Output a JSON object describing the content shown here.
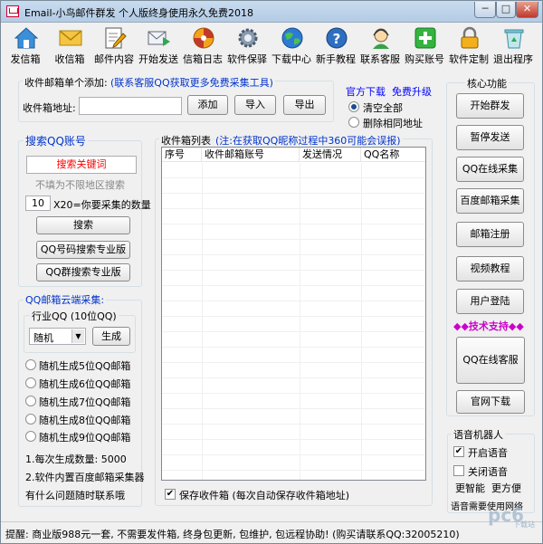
{
  "window": {
    "title": "Email-小鸟邮件群发 个人版终身使用永久免费2018",
    "min": "─",
    "max": "□",
    "close": "✕"
  },
  "toolbar": [
    {
      "label": "发信箱",
      "icon": "home-icon",
      "name": "tool-send-box"
    },
    {
      "label": "收信箱",
      "icon": "envelope-icon",
      "name": "tool-inbox"
    },
    {
      "label": "邮件内容",
      "icon": "edit-document-icon",
      "name": "tool-mail-content"
    },
    {
      "label": "开始发送",
      "icon": "send-mail-icon",
      "name": "tool-start-send"
    },
    {
      "label": "信箱日志",
      "icon": "log-disc-icon",
      "name": "tool-mailbox-log"
    },
    {
      "label": "软件保驿",
      "icon": "gear-icon",
      "name": "tool-settings"
    },
    {
      "label": "下载中心",
      "icon": "globe-icon",
      "name": "tool-download-center"
    },
    {
      "label": "新手教程",
      "icon": "help-icon",
      "name": "tool-tutorial"
    },
    {
      "label": "联系客服",
      "icon": "customer-service-icon",
      "name": "tool-contact"
    },
    {
      "label": "购买账号",
      "icon": "plus-icon",
      "name": "tool-buy-account"
    },
    {
      "label": "软件定制",
      "icon": "lock-icon",
      "name": "tool-customize"
    },
    {
      "label": "退出程序",
      "icon": "recycle-bin-icon",
      "name": "tool-exit"
    }
  ],
  "add_inbox": {
    "title": "收件邮箱单个添加:",
    "tip": "(联系客服QQ获取更多免费采集工具)",
    "address_label": "收件箱地址:",
    "add": "添加",
    "import": "导入",
    "export": "导出"
  },
  "official": {
    "download": "官方下载",
    "upgrade": "免费升级",
    "clear_all": "清空全部",
    "delete_same": "删除相同地址"
  },
  "search_qq": {
    "title": "搜索QQ账号",
    "keyword_placeholder": "搜索关键词",
    "region_placeholder": "不填为不限地区搜索",
    "count": "10",
    "count_label": "X20=你要采集的数量",
    "search": "搜索",
    "pro_qq": "QQ号码搜索专业版",
    "pro_group": "QQ群搜索专业版"
  },
  "cloud": {
    "title": "QQ邮箱云端采集:",
    "industry_title": "行业QQ (10位QQ)",
    "select_value": "随机",
    "generate": "生成",
    "options": [
      "随机生成5位QQ邮箱",
      "随机生成6位QQ邮箱",
      "随机生成7位QQ邮箱",
      "随机生成8位QQ邮箱",
      "随机生成9位QQ邮箱"
    ],
    "note1": "1.每次生成数量: 5000",
    "note2": "2.软件内置百度邮箱采集器",
    "note3": "有什么问题随时联系哦"
  },
  "inbox_list": {
    "title": "收件箱列表",
    "note": "(注:在获取QQ昵称过程中360可能会误报)",
    "columns": [
      "序号",
      "收件邮箱账号",
      "发送情况",
      "QQ名称"
    ],
    "save_label": "保存收件箱 (每次自动保存收件箱地址)"
  },
  "core": {
    "title": "核心功能",
    "buttons": [
      "开始群发",
      "暂停发送",
      "QQ在线采集",
      "百度邮箱采集",
      "邮箱注册",
      "视频教程",
      "用户登陆"
    ],
    "support": "◆◆技术支持◆◆",
    "qq_service": "QQ在线客服",
    "website": "官网下载"
  },
  "voice": {
    "title": "语音机器人",
    "enable": "开启语音",
    "disable": "关闭语音",
    "smart": "更智能",
    "convenient": "更方便",
    "need_network": "语音需要使用网络"
  },
  "status": {
    "text": "提醒: 商业版988元一套, 不需要发件箱, 终身包更新, 包维护, 包远程协助! (购买请联系QQ:32005210)"
  },
  "watermark": {
    "text": "pc6",
    "sub": "下载站"
  },
  "colors": {
    "red": "#ff0000",
    "blue": "#0000ff",
    "magenta": "#cc00cc",
    "title_blue": "#0033cc"
  }
}
